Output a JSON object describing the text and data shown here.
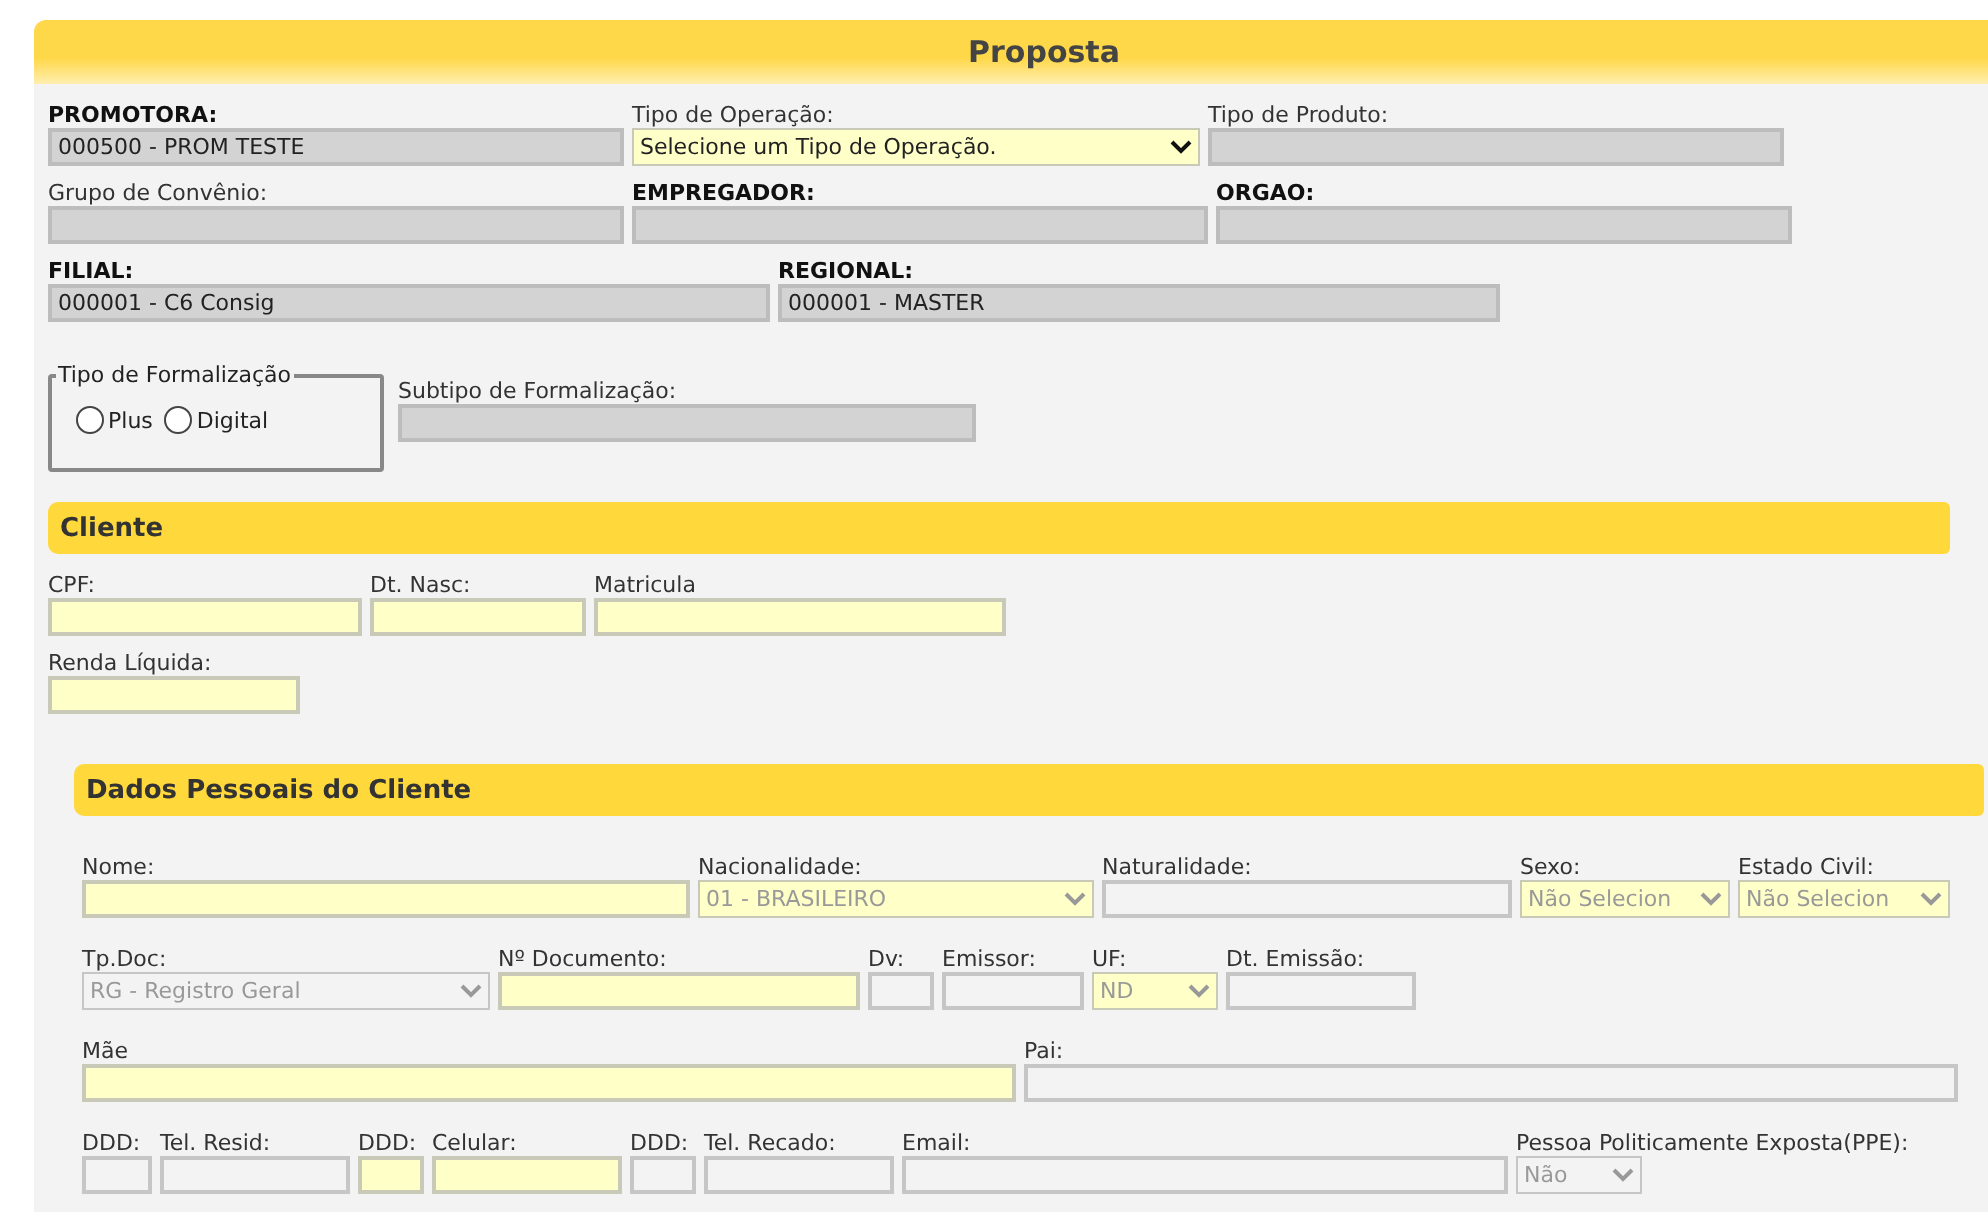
{
  "title": "Proposta",
  "header_lines": [
    {
      "fields": [
        {
          "label": "PROMOTORA:",
          "bold": true,
          "kind": "input",
          "readonly": true,
          "value": "000500 - PROM TESTE"
        },
        {
          "label": "Tipo de Operação:",
          "bold": false,
          "kind": "select",
          "readonly": false,
          "required": true,
          "value": "Selecione um Tipo de Operação.",
          "disabled": false
        },
        {
          "label": "Tipo de Produto:",
          "bold": false,
          "kind": "input",
          "readonly": true
        }
      ]
    },
    {
      "fields": [
        {
          "label": "Grupo de Convênio:",
          "bold": false,
          "kind": "input",
          "readonly": true
        },
        {
          "label": "EMPREGADOR:",
          "bold": true,
          "kind": "input",
          "readonly": true
        },
        {
          "label": "ORGAO:",
          "bold": true,
          "kind": "input",
          "readonly": true
        }
      ]
    },
    {
      "fields": [
        {
          "label": "FILIAL:",
          "bold": true,
          "kind": "input",
          "readonly": true,
          "value": "000001 - C6 Consig"
        },
        {
          "label": "REGIONAL:",
          "bold": true,
          "kind": "input",
          "readonly": true,
          "value": "000001 - MASTER"
        }
      ]
    }
  ],
  "formalizacao": {
    "legend": "Tipo de Formalização",
    "options": [
      {
        "label": "Plus",
        "selected": false
      },
      {
        "label": "Digital",
        "selected": false
      }
    ]
  },
  "subtipo": {
    "label": "Subtipo de Formalização:",
    "bold": false,
    "kind": "input",
    "readonly": true
  },
  "sections": [
    {
      "title": "Cliente",
      "lines": [
        {
          "fields": [
            {
              "label": "CPF:",
              "bold": false,
              "kind": "input",
              "readonly": false,
              "required": true
            },
            {
              "label": "Dt. Nasc:",
              "bold": false,
              "kind": "input",
              "readonly": false,
              "required": true
            },
            {
              "label": "Matricula",
              "bold": false,
              "kind": "input",
              "readonly": false,
              "required": true
            }
          ]
        },
        {
          "fields": [
            {
              "label": "Renda Líquida:",
              "bold": false,
              "kind": "input",
              "readonly": false,
              "required": true
            }
          ]
        }
      ]
    },
    {
      "title": "Dados Pessoais do Cliente",
      "lines": [
        {
          "fields": [
            {
              "label": "Nome:",
              "bold": false,
              "kind": "input",
              "readonly": false,
              "required": true
            },
            {
              "label": "Nacionalidade:",
              "bold": false,
              "kind": "select",
              "readonly": false,
              "required": true,
              "value": "01 - BRASILEIRO",
              "disabled": true
            },
            {
              "label": "Naturalidade:",
              "bold": false,
              "kind": "input",
              "readonly": false,
              "required": false
            },
            {
              "label": "Sexo:",
              "bold": false,
              "kind": "select",
              "readonly": false,
              "required": true,
              "value": "Não Selecion",
              "disabled": true
            },
            {
              "label": "Estado Civil:",
              "bold": false,
              "kind": "select",
              "readonly": false,
              "required": true,
              "value": "Não Selecion",
              "disabled": true
            }
          ]
        },
        {
          "fields": [
            {
              "label": "Tp.Doc:",
              "bold": false,
              "kind": "select",
              "readonly": false,
              "required": false,
              "value": "RG - Registro Geral",
              "disabled": true
            },
            {
              "label": "Nº Documento:",
              "bold": false,
              "kind": "input",
              "readonly": false,
              "required": true
            },
            {
              "label": "Dv:",
              "bold": false,
              "kind": "input",
              "readonly": false,
              "required": false
            },
            {
              "label": "Emissor:",
              "bold": false,
              "kind": "input",
              "readonly": false,
              "required": false
            },
            {
              "label": "UF:",
              "bold": false,
              "kind": "select",
              "readonly": false,
              "required": true,
              "value": "ND",
              "disabled": true
            },
            {
              "label": "Dt. Emissão:",
              "bold": false,
              "kind": "input",
              "readonly": false,
              "required": false
            }
          ]
        },
        {
          "fields": [
            {
              "label": "Mãe",
              "bold": false,
              "kind": "input",
              "readonly": false,
              "required": true
            },
            {
              "label": "Pai:",
              "bold": false,
              "kind": "input",
              "readonly": false,
              "required": false
            }
          ]
        },
        {
          "fields": [
            {
              "label": "DDD:",
              "bold": false,
              "kind": "input",
              "readonly": false,
              "required": false
            },
            {
              "label": "Tel. Resid:",
              "bold": false,
              "kind": "input",
              "readonly": false,
              "required": false
            },
            {
              "label": "DDD:",
              "bold": false,
              "kind": "input",
              "readonly": false,
              "required": true
            },
            {
              "label": "Celular:",
              "bold": false,
              "kind": "input",
              "readonly": false,
              "required": true
            },
            {
              "label": "DDD:",
              "bold": false,
              "kind": "input",
              "readonly": false,
              "required": false
            },
            {
              "label": "Tel. Recado:",
              "bold": false,
              "kind": "input",
              "readonly": false,
              "required": false
            },
            {
              "label": "Email:",
              "bold": false,
              "kind": "input",
              "readonly": false,
              "required": false
            },
            {
              "label": "Pessoa Politicamente Exposta(PPE):",
              "bold": false,
              "kind": "select",
              "readonly": false,
              "required": false,
              "value": "Não",
              "disabled": true
            }
          ]
        }
      ]
    }
  ]
}
